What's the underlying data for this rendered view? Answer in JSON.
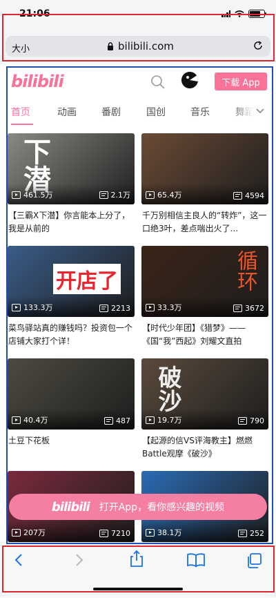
{
  "status_bar": {
    "time": "21:06",
    "battery_level": 0.85
  },
  "browser": {
    "text_size_label": "大小",
    "url": "bilibili.com"
  },
  "header": {
    "logo_text": "bilibili",
    "download_button": "下载 App"
  },
  "tabs": [
    {
      "label": "首页",
      "active": true
    },
    {
      "label": "动画",
      "active": false
    },
    {
      "label": "番剧",
      "active": false
    },
    {
      "label": "国创",
      "active": false
    },
    {
      "label": "音乐",
      "active": false
    },
    {
      "label": "舞蹈",
      "active": false
    }
  ],
  "videos": [
    {
      "views": "461.5万",
      "danmaku": "2.1万",
      "title": "【三霸X下潜】你言能本上分了，我是从前的",
      "thumb_color": "#8a8a84",
      "overlay_text": "下潜"
    },
    {
      "views": "65.4万",
      "danmaku": "4594",
      "title": "千万别相信主良人的“转炸”，这一口绝3叶，差点喘出火了...",
      "thumb_color": "#6b4a35",
      "overlay_text": ""
    },
    {
      "views": "133.3万",
      "danmaku": "2213",
      "title": "菜鸟驿站真的赚钱吗？投资包一个店铺大家打个详！",
      "thumb_color": "#3a5c88",
      "overlay_text": "开店了"
    },
    {
      "views": "33.3万",
      "danmaku": "3672",
      "title": "【时代少年团】《猎梦》——《国“我”西起》刘耀文直拍",
      "thumb_color": "#3b2418",
      "overlay_text": "循环"
    },
    {
      "views": "40.4万",
      "danmaku": "487",
      "title": "土豆下花板",
      "thumb_color": "#4d4a40",
      "overlay_text": ""
    },
    {
      "views": "19.7万",
      "danmaku": "790",
      "title": "【起源的信VS评海教主】燃燃Battle观摩《破沙》",
      "thumb_color": "#5a4a3c",
      "overlay_text": "破沙"
    },
    {
      "views": "207万",
      "danmaku": "7210",
      "title": "",
      "thumb_color": "#7a2a3c",
      "overlay_text": ""
    },
    {
      "views": "38.1万",
      "danmaku": "252",
      "title": "",
      "thumb_color": "#2a6cb5",
      "overlay_text": ""
    }
  ],
  "open_app_banner": {
    "logo_text": "bilibili",
    "text": "打开App，看你感兴趣的视频"
  },
  "colors": {
    "brand_pink": "#fb7299",
    "annotation_red": "#e0242c",
    "annotation_blue": "#1f4fb5"
  },
  "toolbar_icons": [
    "back-arrow-icon",
    "forward-arrow-icon",
    "share-icon",
    "bookmarks-icon",
    "tabs-icon"
  ]
}
